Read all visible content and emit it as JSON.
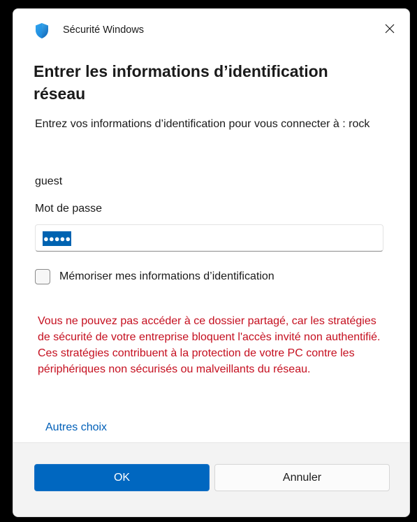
{
  "window": {
    "app_title": "Sécurité Windows",
    "app_icon": "shield-icon",
    "close_icon": "close-icon"
  },
  "dialog": {
    "heading": "Entrer les informations d’identification réseau",
    "subtitle": "Entrez vos informations d’identification pour vous connecter à : rock",
    "username": "guest",
    "password_label": "Mot de passe",
    "password_value": "●●●●●",
    "remember_label": "Mémoriser mes informations d’identification",
    "remember_checked": false,
    "error_message": "Vous ne pouvez pas accéder à ce dossier partagé, car les stratégies de sécurité de votre entreprise bloquent l'accès invité non authentifié. Ces stratégies contribuent à la protection de votre PC contre les périphériques non sécurisés ou malveillants du réseau.",
    "more_choices_link": "Autres choix"
  },
  "footer": {
    "ok_label": "OK",
    "cancel_label": "Annuler"
  },
  "colors": {
    "accent": "#0067c0",
    "error": "#c50f1f",
    "link": "#005fb8"
  }
}
